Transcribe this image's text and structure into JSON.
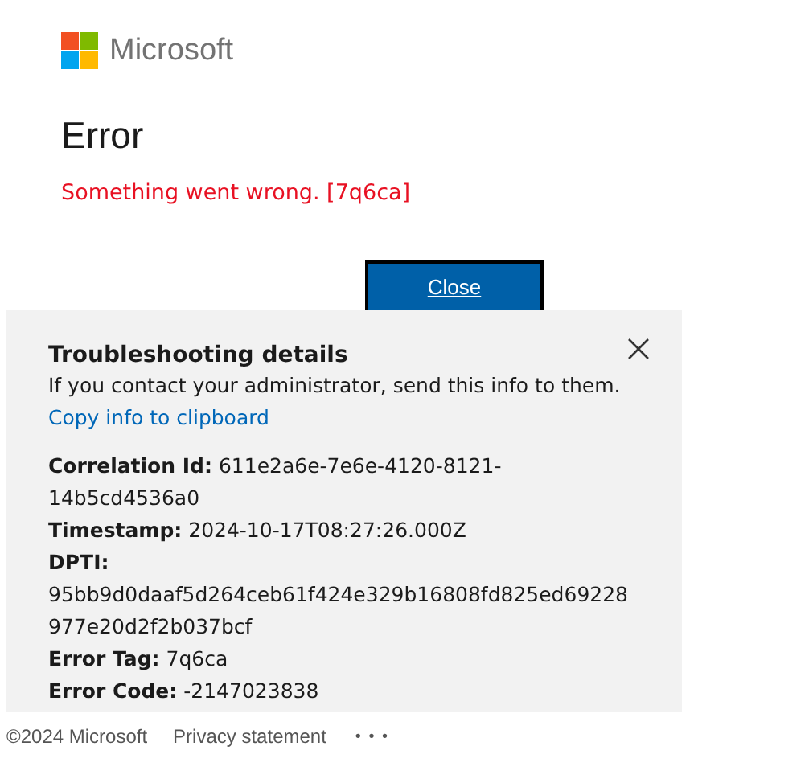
{
  "brand": {
    "name": "Microsoft"
  },
  "heading": "Error",
  "message": "Something went wrong. [7q6ca]",
  "close_button": "Close",
  "troubleshooting": {
    "title": "Troubleshooting details",
    "description": "If you contact your administrator, send this info to them.",
    "copy_link": "Copy info to clipboard",
    "details": [
      {
        "text": "**Correlation Id:** 611e2a6e-7e6e-4120-8121-14b5cd4536a0"
      },
      {
        "text": "**Timestamp:** 2024-10-17T08:27:26.000Z"
      },
      {
        "text": "**DPTI:** 95bb9d0daaf5d264ceb61f424e329b16808fd825ed69228977e20d2f2b037bcf"
      },
      {
        "text": "**Error Tag:** 7q6ca"
      },
      {
        "text": "**Error Code:** -2147023838"
      }
    ]
  },
  "footer": {
    "copyright": "©2024 Microsoft",
    "privacy_link": "Privacy statement",
    "more_button": "• • •"
  }
}
